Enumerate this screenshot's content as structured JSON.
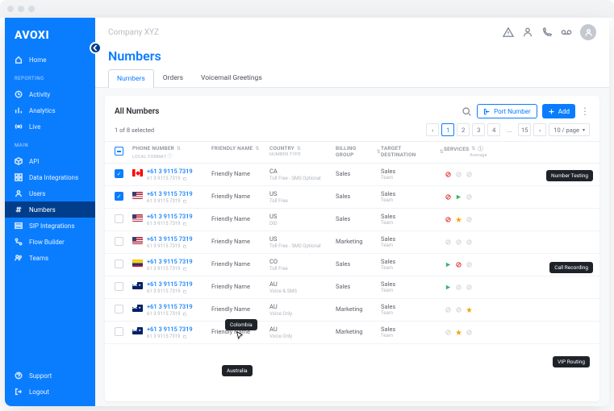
{
  "brand": "AVOXI",
  "company": "Company XYZ",
  "page_title": "Numbers",
  "sidebar": {
    "top": [
      {
        "label": "Home",
        "icon": "home"
      }
    ],
    "section_reporting": "REPORTING",
    "reporting": [
      {
        "label": "Activity",
        "icon": "clock"
      },
      {
        "label": "Analytics",
        "icon": "bar-chart"
      },
      {
        "label": "Live",
        "icon": "live"
      }
    ],
    "section_main": "MAIN",
    "main_items": [
      {
        "label": "API",
        "icon": "cube"
      },
      {
        "label": "Data Integrations",
        "icon": "grid"
      },
      {
        "label": "Users",
        "icon": "user"
      },
      {
        "label": "Numbers",
        "icon": "hash",
        "active": true
      },
      {
        "label": "SIP Integrations",
        "icon": "server"
      },
      {
        "label": "Flow Builder",
        "icon": "flow"
      },
      {
        "label": "Teams",
        "icon": "team"
      }
    ],
    "bottom": [
      {
        "label": "Support",
        "icon": "support"
      },
      {
        "label": "Logout",
        "icon": "logout"
      }
    ]
  },
  "tabs": [
    {
      "label": "Numbers",
      "active": true
    },
    {
      "label": "Orders"
    },
    {
      "label": "Voicemail Greetings"
    }
  ],
  "card": {
    "title": "All Numbers",
    "port_btn": "Port Number",
    "add_btn": "Add",
    "selection": "1 of 8 selected",
    "pages": [
      "1",
      "2",
      "3",
      "4",
      "...",
      "15"
    ],
    "active_page": "1",
    "per_page": "10 / page"
  },
  "columns": {
    "phone": "PHONE NUMBER",
    "phone_sub": "LOCAL FORMAT",
    "friendly": "FRIENDLY NAME",
    "country": "COUNTRY",
    "country_sub": "NUMBER TYPE",
    "billing": "BILLING GROUP",
    "target": "TARGET DESTINATION",
    "services": "SERVICES",
    "services_avg": "Average"
  },
  "rows": [
    {
      "checked": true,
      "flag": "ca",
      "phone": "+61 3 9115 7319",
      "local": "61 3 9115 7319",
      "friendly": "Friendly Name",
      "country": "CA",
      "type": "Toll Free - SMS Optional",
      "billing": "Sales",
      "dest": "Sales",
      "dest_sub": "Team",
      "svc": [
        "red",
        "disabled",
        "disabled"
      ]
    },
    {
      "checked": true,
      "flag": "us",
      "phone": "+61 3 9115 7319",
      "local": "61 3 9115 7319",
      "friendly": "Friendly Name",
      "country": "US",
      "type": "Toll Free",
      "billing": "Sales",
      "dest": "Sales",
      "dest_sub": "Team",
      "svc": [
        "red",
        "green",
        "disabled"
      ]
    },
    {
      "checked": false,
      "flag": "us",
      "phone": "+61 3 9115 7319",
      "local": "61 3 9115 7319",
      "friendly": "Friendly Name",
      "country": "US",
      "type": "DID",
      "billing": "Sales",
      "dest": "Sales",
      "dest_sub": "Team",
      "svc": [
        "red",
        "yellow",
        "disabled"
      ]
    },
    {
      "checked": false,
      "flag": "us",
      "phone": "+61 3 9115 7319",
      "local": "61 3 9115 7319",
      "friendly": "Friendly Name",
      "country": "US",
      "type": "Toll Free - SMS Optional",
      "billing": "Marketing",
      "dest": "Sales",
      "dest_sub": "Team",
      "svc": [
        "disabled",
        "disabled",
        "disabled"
      ]
    },
    {
      "checked": false,
      "flag": "co",
      "phone": "+61 3 9115 7319",
      "local": "61 3 9115 7319",
      "friendly": "Friendly Name",
      "country": "CO",
      "type": "Toll Free",
      "billing": "Sales",
      "dest": "Sales",
      "dest_sub": "Team",
      "svc": [
        "green",
        "red",
        "disabled"
      ]
    },
    {
      "checked": false,
      "flag": "au",
      "phone": "+61 3 9115 7319",
      "local": "61 3 9115 7319",
      "friendly": "Friendly Name",
      "country": "AU",
      "type": "Voice & SMS",
      "billing": "Sales",
      "dest": "Sales",
      "dest_sub": "Team",
      "svc": [
        "green",
        "disabled",
        "disabled"
      ]
    },
    {
      "checked": false,
      "flag": "au",
      "phone": "+61 3 9115 7319",
      "local": "61 3 9115 7319",
      "friendly": "Friendly Name",
      "country": "AU",
      "type": "Voice Only",
      "billing": "Marketing",
      "dest": "Sales",
      "dest_sub": "Team",
      "svc": [
        "disabled",
        "disabled",
        "yellow"
      ]
    },
    {
      "checked": false,
      "flag": "au",
      "phone": "+61 3 9115 7319",
      "local": "61 3 9115 7319",
      "friendly": "Friendly Name",
      "country": "AU",
      "type": "Voice Only",
      "billing": "Marketing",
      "dest": "Sales",
      "dest_sub": "Team",
      "svc": [
        "disabled",
        "yellow",
        "disabled"
      ]
    }
  ],
  "tooltips": {
    "colombia": "Colombia",
    "australia": "Australia",
    "number_testing": "Number Testing",
    "call_recording": "Call Recording",
    "vip_routing": "VIP Routing"
  }
}
